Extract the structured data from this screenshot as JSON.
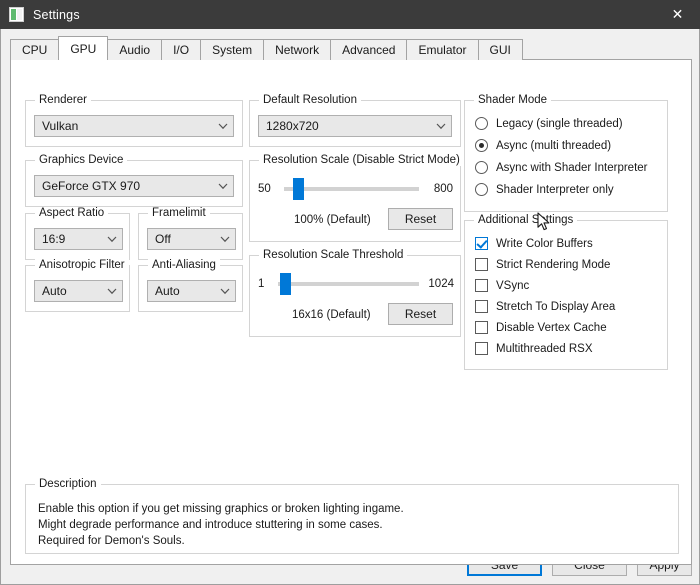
{
  "window": {
    "title": "Settings",
    "icon": "app-icon",
    "close_label": "✕"
  },
  "tabs": [
    {
      "label": "CPU",
      "active": false
    },
    {
      "label": "GPU",
      "active": true
    },
    {
      "label": "Audio",
      "active": false
    },
    {
      "label": "I/O",
      "active": false
    },
    {
      "label": "System",
      "active": false
    },
    {
      "label": "Network",
      "active": false
    },
    {
      "label": "Advanced",
      "active": false
    },
    {
      "label": "Emulator",
      "active": false
    },
    {
      "label": "GUI",
      "active": false
    }
  ],
  "groups": {
    "renderer": {
      "title": "Renderer",
      "value": "Vulkan"
    },
    "graphics_device": {
      "title": "Graphics Device",
      "value": "GeForce GTX 970"
    },
    "aspect_ratio": {
      "title": "Aspect Ratio",
      "value": "16:9"
    },
    "framelimit": {
      "title": "Framelimit",
      "value": "Off"
    },
    "anisotropic_filter": {
      "title": "Anisotropic Filter",
      "value": "Auto"
    },
    "anti_aliasing": {
      "title": "Anti-Aliasing",
      "value": "Auto"
    },
    "default_resolution": {
      "title": "Default Resolution",
      "value": "1280x720"
    },
    "resolution_scale": {
      "title": "Resolution Scale (Disable Strict Mode)",
      "min_label": "50",
      "max_label": "800",
      "value_label": "100% (Default)",
      "reset_label": "Reset",
      "handle_percent": 7
    },
    "resolution_scale_threshold": {
      "title": "Resolution Scale Threshold",
      "min_label": "1",
      "max_label": "1024",
      "value_label": "16x16 (Default)",
      "reset_label": "Reset",
      "handle_percent": 2
    },
    "shader_mode": {
      "title": "Shader Mode",
      "options": [
        {
          "label": "Legacy (single threaded)",
          "checked": false
        },
        {
          "label": "Async (multi threaded)",
          "checked": true
        },
        {
          "label": "Async with Shader Interpreter",
          "checked": false
        },
        {
          "label": "Shader Interpreter only",
          "checked": false
        }
      ]
    },
    "additional_settings": {
      "title": "Additional Settings",
      "options": [
        {
          "label": "Write Color Buffers",
          "checked": true
        },
        {
          "label": "Strict Rendering Mode",
          "checked": false
        },
        {
          "label": "VSync",
          "checked": false
        },
        {
          "label": "Stretch To Display Area",
          "checked": false
        },
        {
          "label": "Disable Vertex Cache",
          "checked": false
        },
        {
          "label": "Multithreaded RSX",
          "checked": false
        }
      ]
    },
    "description": {
      "title": "Description",
      "text": "Enable this option if you get missing graphics or broken lighting ingame.\nMight degrade performance and introduce stuttering in some cases.\nRequired for Demon's Souls."
    }
  },
  "footer": {
    "save_label": "Save",
    "close_label": "Close",
    "apply_label": "Apply"
  },
  "colors": {
    "titlebar": "#3b3b3b",
    "accent": "#0078d7",
    "panel": "#ffffff",
    "chrome": "#f0f0f0"
  }
}
